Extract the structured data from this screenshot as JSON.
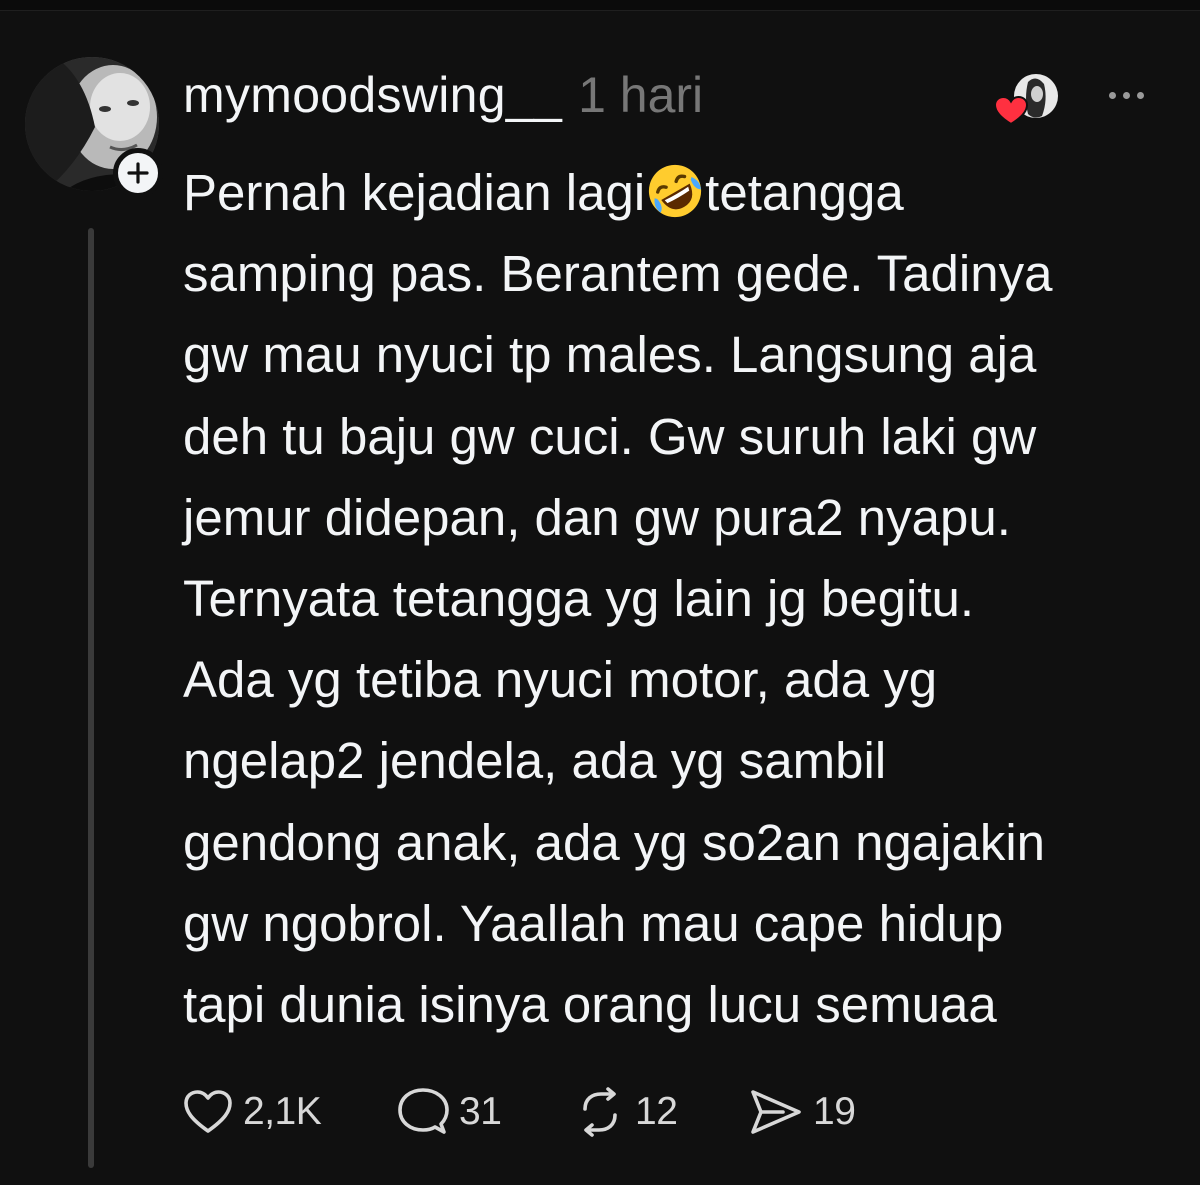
{
  "post": {
    "username": "mymoodswing__",
    "timestamp": "1 hari",
    "text_lines": [
      [
        "Pernah kejadian lagi",
        "tetangga"
      ],
      "samping pas. Berantem gede. Tadinya",
      "gw mau nyuci tp males. Langsung aja",
      "deh tu baju gw cuci. Gw suruh laki gw",
      "jemur didepan, dan gw pura2 nyapu.",
      "Ternyata tetangga yg lain jg begitu.",
      "Ada yg tetiba nyuci motor, ada yg",
      "ngelap2 jendela, ada yg sambil",
      "gendong anak, ada yg so2an ngajakin",
      "gw ngobrol. Yaallah mau cape hidup",
      "tapi dunia isinya orang lucu semuaa"
    ],
    "inline_emoji": "rolling-on-the-floor-laughing-emoji"
  },
  "actions": {
    "likes": "2,1K",
    "replies": "31",
    "reposts": "12",
    "shares": "19"
  },
  "icons": {
    "like": "heart-icon",
    "reply": "speech-bubble-icon",
    "repost": "repost-arrows-icon",
    "share": "send-icon",
    "more": "ellipsis-icon",
    "follow": "plus-icon"
  },
  "colors": {
    "background": "#101010",
    "text": "#f3f5f7",
    "muted": "#777777",
    "heart_badge": "#ff3040"
  }
}
